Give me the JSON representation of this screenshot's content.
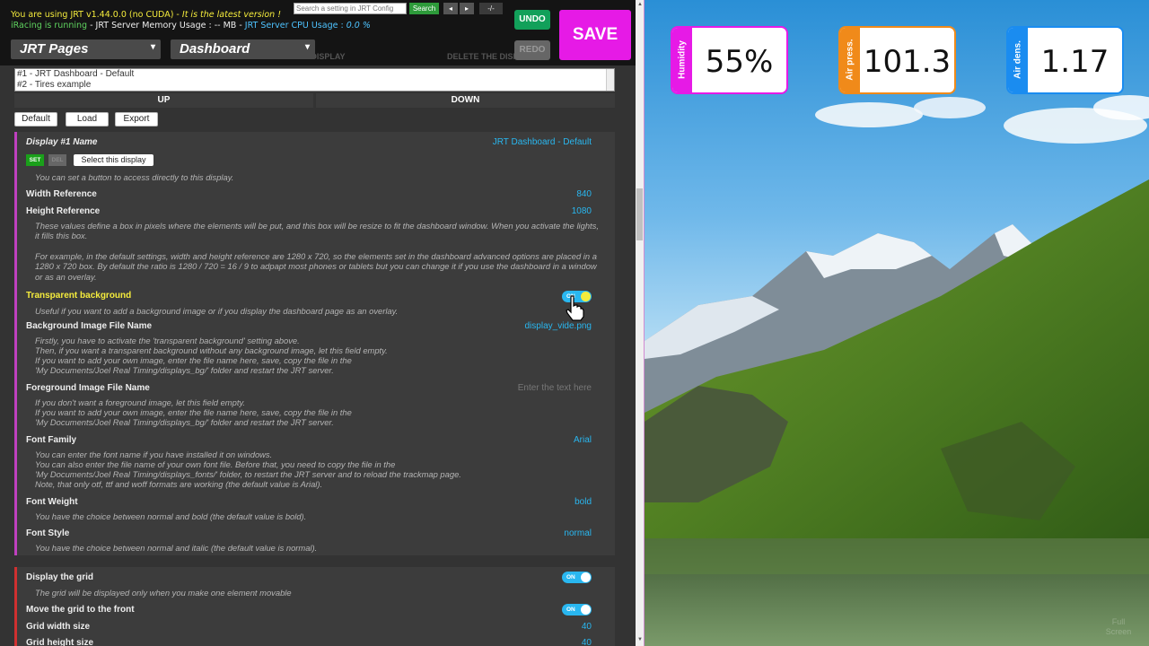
{
  "status": {
    "line1_a": "You are using JRT v1.44.0.0 (no CUDA) - ",
    "line1_b": "It is the latest version !",
    "line2_a": "iRacing is running",
    "line2_b": " - JRT Server Memory Usage : -- MB - ",
    "line2_c": "JRT Server CPU Usage : ",
    "line2_d": "0.0 %"
  },
  "search": {
    "placeholder": "Search a setting in JRT Config",
    "button": "Search",
    "prev": "◂",
    "next": "▸",
    "sep": "-/-"
  },
  "pages_select": "JRT Pages",
  "dashboard_select": "Dashboard",
  "toolbar": {
    "undo": "UNDO",
    "redo": "REDO",
    "save": "SAVE",
    "ghost_add": "ADD A DISPLAY",
    "ghost_delete": "DELETE THE DISPLAY"
  },
  "displays": [
    "#1 - JRT Dashboard - Default",
    "#2 - Tires example"
  ],
  "order": {
    "up": "UP",
    "down": "DOWN"
  },
  "actions": {
    "default": "Default",
    "load": "Load",
    "export": "Export"
  },
  "display_name": {
    "label": "Display #1 Name",
    "value": "JRT Dashboard - Default",
    "set": "SET",
    "del": "DEL",
    "select": "Select this display",
    "desc": "You can set a button to access directly to this display."
  },
  "width_ref": {
    "label": "Width Reference",
    "value": "840"
  },
  "height_ref": {
    "label": "Height Reference",
    "value": "1080",
    "desc1": "These values define a box in pixels where the elements will be put, and this box will be resize to fit the dashboard window. When you activate the lights, it fills this box.",
    "desc2": "For example, in the default settings, width and height reference are 1280 x 720, so the elements set in the dashboard advanced options are placed in a 1280 x 720 box. By default the ratio is 1280 / 720 = 16 / 9 to adpapt most phones or tablets but you can change it if you use the dashboard in a window or as an overlay."
  },
  "transparent_bg": {
    "label": "Transparent background",
    "toggle": "ON",
    "desc": "Useful if you want to add a background image or if you display the dashboard page as an overlay."
  },
  "bg_image": {
    "label": "Background Image File Name",
    "value": "display_vide.png",
    "desc1": "Firstly, you have to activate the 'transparent background' setting above.",
    "desc2": "Then, if you want a transparent background without any background image, let this field empty.",
    "desc3": "If you want to add your own image, enter the file name here, save, copy the file in the",
    "desc4": "'My Documents/Joel Real Timing/displays_bg/' folder and restart the JRT server."
  },
  "fg_image": {
    "label": "Foreground Image File Name",
    "placeholder": "Enter the text here",
    "desc1": "If you don't want a foreground image, let this field empty.",
    "desc2": "If you want to add your own image, enter the file name here, save, copy the file in the",
    "desc3": "'My Documents/Joel Real Timing/displays_bg/' folder and restart the JRT server."
  },
  "font_family": {
    "label": "Font Family",
    "value": "Arial",
    "desc1": "You can enter the font name if you have installed it on windows.",
    "desc2": "You can also enter the file name of your own font file. Before that, you need to copy the file in the",
    "desc3": "'My Documents/Joel Real Timing/displays_fonts/' folder, to restart the JRT server and to reload the trackmap page.",
    "desc4": "Note, that only otf, ttf and woff formats are working (the default value is Arial)."
  },
  "font_weight": {
    "label": "Font Weight",
    "value": "bold",
    "desc": "You have the choice between normal and bold (the default value is bold)."
  },
  "font_style": {
    "label": "Font Style",
    "value": "normal",
    "desc": "You have the choice between normal and italic (the default value is normal)."
  },
  "grid": {
    "label": "Display the grid",
    "toggle": "ON",
    "desc": "The grid will be displayed only when you make one element movable"
  },
  "grid_front": {
    "label": "Move the grid to the front",
    "toggle": "ON"
  },
  "grid_width": {
    "label": "Grid width size",
    "value": "40"
  },
  "grid_height": {
    "label": "Grid height size",
    "value": "40"
  },
  "gauges": [
    {
      "label": "Humidity",
      "value": "55%",
      "color": "#e61ae6"
    },
    {
      "label": "Air press.",
      "value": "101.3",
      "color": "#f08a1a"
    },
    {
      "label": "Air dens.",
      "value": "1.17",
      "color": "#1a8cf0"
    }
  ],
  "fullscreen": "Full Screen"
}
